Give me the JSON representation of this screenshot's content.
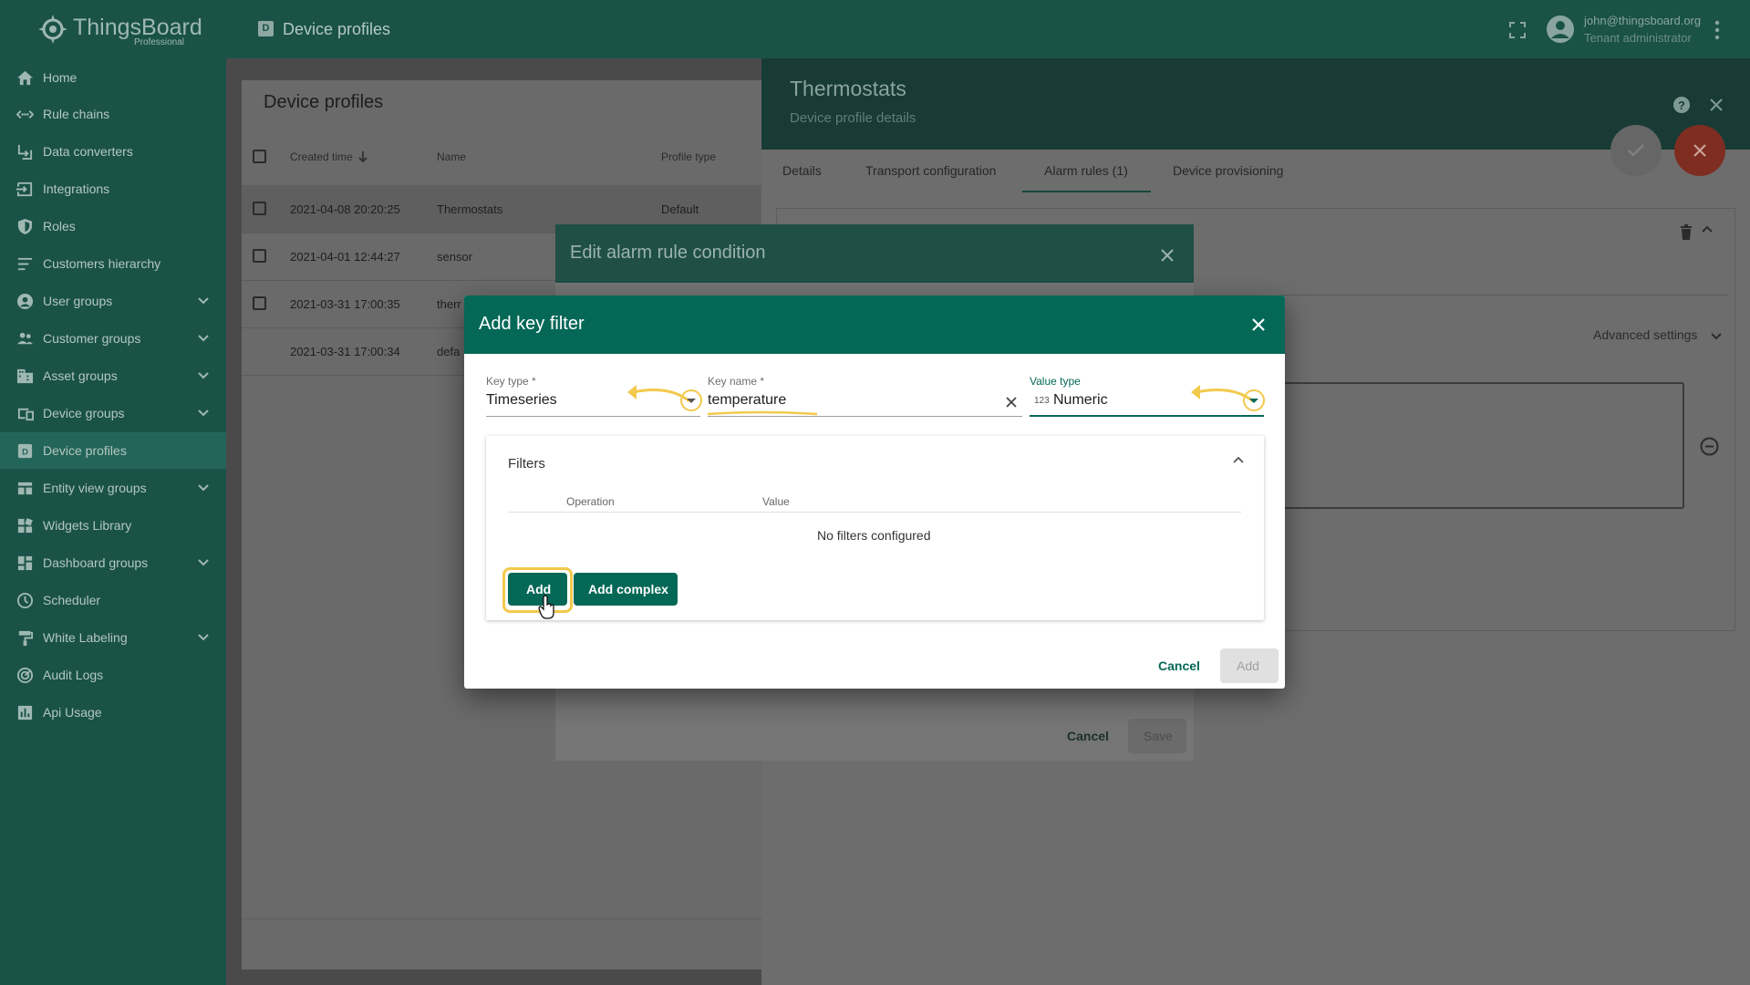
{
  "app": {
    "logo_text": "ThingsBoard",
    "logo_sub": "Professional",
    "breadcrumb_badge": "D",
    "breadcrumb": "Device profiles",
    "user_email": "john@thingsboard.org",
    "user_role": "Tenant administrator"
  },
  "sidebar": {
    "items": [
      {
        "label": "Home",
        "icon": "home-icon"
      },
      {
        "label": "Rule chains",
        "icon": "rule-chains-icon"
      },
      {
        "label": "Data converters",
        "icon": "converter-icon"
      },
      {
        "label": "Integrations",
        "icon": "integration-icon"
      },
      {
        "label": "Roles",
        "icon": "shield-icon"
      },
      {
        "label": "Customers hierarchy",
        "icon": "hierarchy-icon"
      },
      {
        "label": "User groups",
        "icon": "account-icon"
      },
      {
        "label": "Customer groups",
        "icon": "people-icon"
      },
      {
        "label": "Asset groups",
        "icon": "domain-icon"
      },
      {
        "label": "Device groups",
        "icon": "devices-icon"
      },
      {
        "label": "Device profiles",
        "icon": "device-profile-icon"
      },
      {
        "label": "Entity view groups",
        "icon": "view-icon"
      },
      {
        "label": "Widgets Library",
        "icon": "widgets-icon"
      },
      {
        "label": "Dashboard groups",
        "icon": "dashboard-icon"
      },
      {
        "label": "Scheduler",
        "icon": "clock-icon"
      },
      {
        "label": "White Labeling",
        "icon": "paint-roller-icon"
      },
      {
        "label": "Audit Logs",
        "icon": "track-changes-icon"
      },
      {
        "label": "Api Usage",
        "icon": "insert-chart-icon"
      }
    ]
  },
  "profiles_table": {
    "title": "Device profiles",
    "columns": [
      "Created time",
      "Name",
      "Profile type"
    ],
    "rows": [
      {
        "created": "2021-04-08 20:20:25",
        "name": "Thermostats",
        "type": "Default"
      },
      {
        "created": "2021-04-01 12:44:27",
        "name": "sensor",
        "type": ""
      },
      {
        "created": "2021-03-31 17:00:35",
        "name": "therr",
        "type": ""
      },
      {
        "created": "2021-03-31 17:00:34",
        "name": "defa",
        "type": ""
      }
    ]
  },
  "detail": {
    "title": "Thermostats",
    "subtitle": "Device profile details",
    "tabs": [
      "Details",
      "Transport configuration",
      "Alarm rules (1)",
      "Device provisioning"
    ],
    "advanced_settings": "Advanced settings"
  },
  "edit_dialog": {
    "title": "Edit alarm rule condition",
    "cancel": "Cancel",
    "save": "Save"
  },
  "key_filter": {
    "title": "Add key filter",
    "key_type_label": "Key type *",
    "key_type_value": "Timeseries",
    "key_name_label": "Key name *",
    "key_name_value": "temperature",
    "value_type_label": "Value type",
    "value_type_badge": "123",
    "value_type_value": "Numeric",
    "filters_title": "Filters",
    "col_operation": "Operation",
    "col_value": "Value",
    "empty": "No filters configured",
    "add_btn": "Add",
    "add_complex_btn": "Add complex",
    "cancel": "Cancel",
    "add": "Add"
  },
  "colors": {
    "primary": "#056857",
    "sidebar": "#1a5247",
    "highlight": "#f2c94c",
    "fab_close": "#d04b34"
  }
}
